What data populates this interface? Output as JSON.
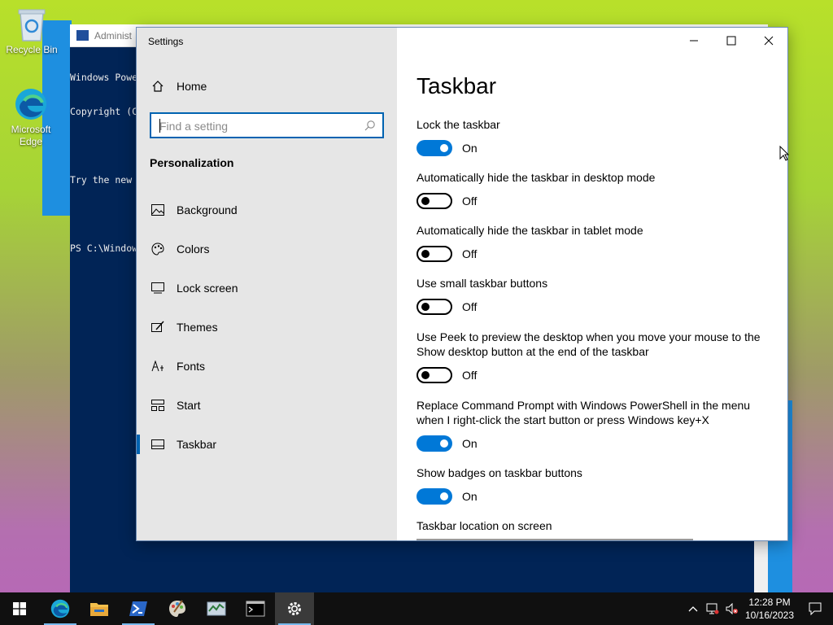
{
  "desktop": {
    "icons": [
      {
        "label": "Recycle Bin"
      },
      {
        "label": "Microsoft Edge"
      }
    ]
  },
  "powershell": {
    "title": "Administ",
    "lines": [
      "Windows Powe",
      "Copyright (C",
      "",
      "Try the new ",
      "",
      "PS C:\\Window"
    ]
  },
  "settings": {
    "window_title": "Settings",
    "home_label": "Home",
    "search_placeholder": "Find a setting",
    "section_heading": "Personalization",
    "nav": [
      {
        "label": "Background",
        "icon": "picture-icon"
      },
      {
        "label": "Colors",
        "icon": "palette-icon"
      },
      {
        "label": "Lock screen",
        "icon": "lock-screen-icon"
      },
      {
        "label": "Themes",
        "icon": "themes-icon"
      },
      {
        "label": "Fonts",
        "icon": "fonts-icon"
      },
      {
        "label": "Start",
        "icon": "start-icon"
      },
      {
        "label": "Taskbar",
        "icon": "taskbar-icon",
        "active": true
      }
    ],
    "page_title": "Taskbar",
    "options": [
      {
        "label": "Lock the taskbar",
        "state": "On"
      },
      {
        "label": "Automatically hide the taskbar in desktop mode",
        "state": "Off"
      },
      {
        "label": "Automatically hide the taskbar in tablet mode",
        "state": "Off"
      },
      {
        "label": "Use small taskbar buttons",
        "state": "Off"
      },
      {
        "label": "Use Peek to preview the desktop when you move your mouse to the Show desktop button at the end of the taskbar",
        "state": "Off"
      },
      {
        "label": "Replace Command Prompt with Windows PowerShell in the menu when I right-click the start button or press Windows key+X",
        "state": "On"
      },
      {
        "label": "Show badges on taskbar buttons",
        "state": "On"
      }
    ],
    "location_label": "Taskbar location on screen"
  },
  "taskbar": {
    "apps": [
      "start-icon",
      "edge-icon",
      "file-explorer-icon",
      "powershell-icon",
      "paint-icon",
      "task-manager-icon",
      "cmd-icon",
      "settings-gear-icon"
    ],
    "time": "12:28 PM",
    "date": "10/16/2023"
  },
  "colors": {
    "accent": "#0078d7",
    "sidebar_bg": "#e6e6e6",
    "taskbar_bg": "#101010",
    "powershell_bg": "#012456"
  }
}
